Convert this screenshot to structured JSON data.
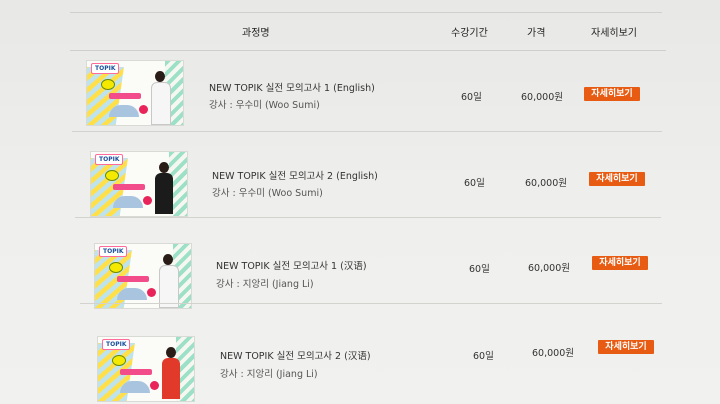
{
  "table": {
    "headers": {
      "course": "과정명",
      "period": "수강기간",
      "price": "가격",
      "detail": "자세히보기"
    },
    "rows": [
      {
        "title": "NEW TOPIK 실전 모의고사 1 (English)",
        "teacher": "강사 : 우수미 (Woo Sumi)",
        "period": "60일",
        "price": "60,000원",
        "button": "자세히보기",
        "thumb_badge": "TOPIK",
        "thumb_person": "white"
      },
      {
        "title": "NEW TOPIK 실전 모의고사 2 (English)",
        "teacher": "강사 : 우수미 (Woo Sumi)",
        "period": "60일",
        "price": "60,000원",
        "button": "자세히보기",
        "thumb_badge": "TOPIK",
        "thumb_person": "black"
      },
      {
        "title": "NEW TOPIK 실전 모의고사 1 (汉语)",
        "teacher": "강사 : 지앙리 (Jiang Li)",
        "period": "60일",
        "price": "60,000원",
        "button": "자세히보기",
        "thumb_badge": "TOPIK",
        "thumb_person": "white"
      },
      {
        "title": "NEW TOPIK 실전 모의고사 2 (汉语)",
        "teacher": "강사 : 지앙리 (Jiang Li)",
        "period": "60일",
        "price": "60,000원",
        "button": "자세히보기",
        "thumb_badge": "TOPIK",
        "thumb_person": "red"
      }
    ]
  },
  "colors": {
    "button_bg": "#e85b12",
    "button_text": "#ffffff"
  }
}
